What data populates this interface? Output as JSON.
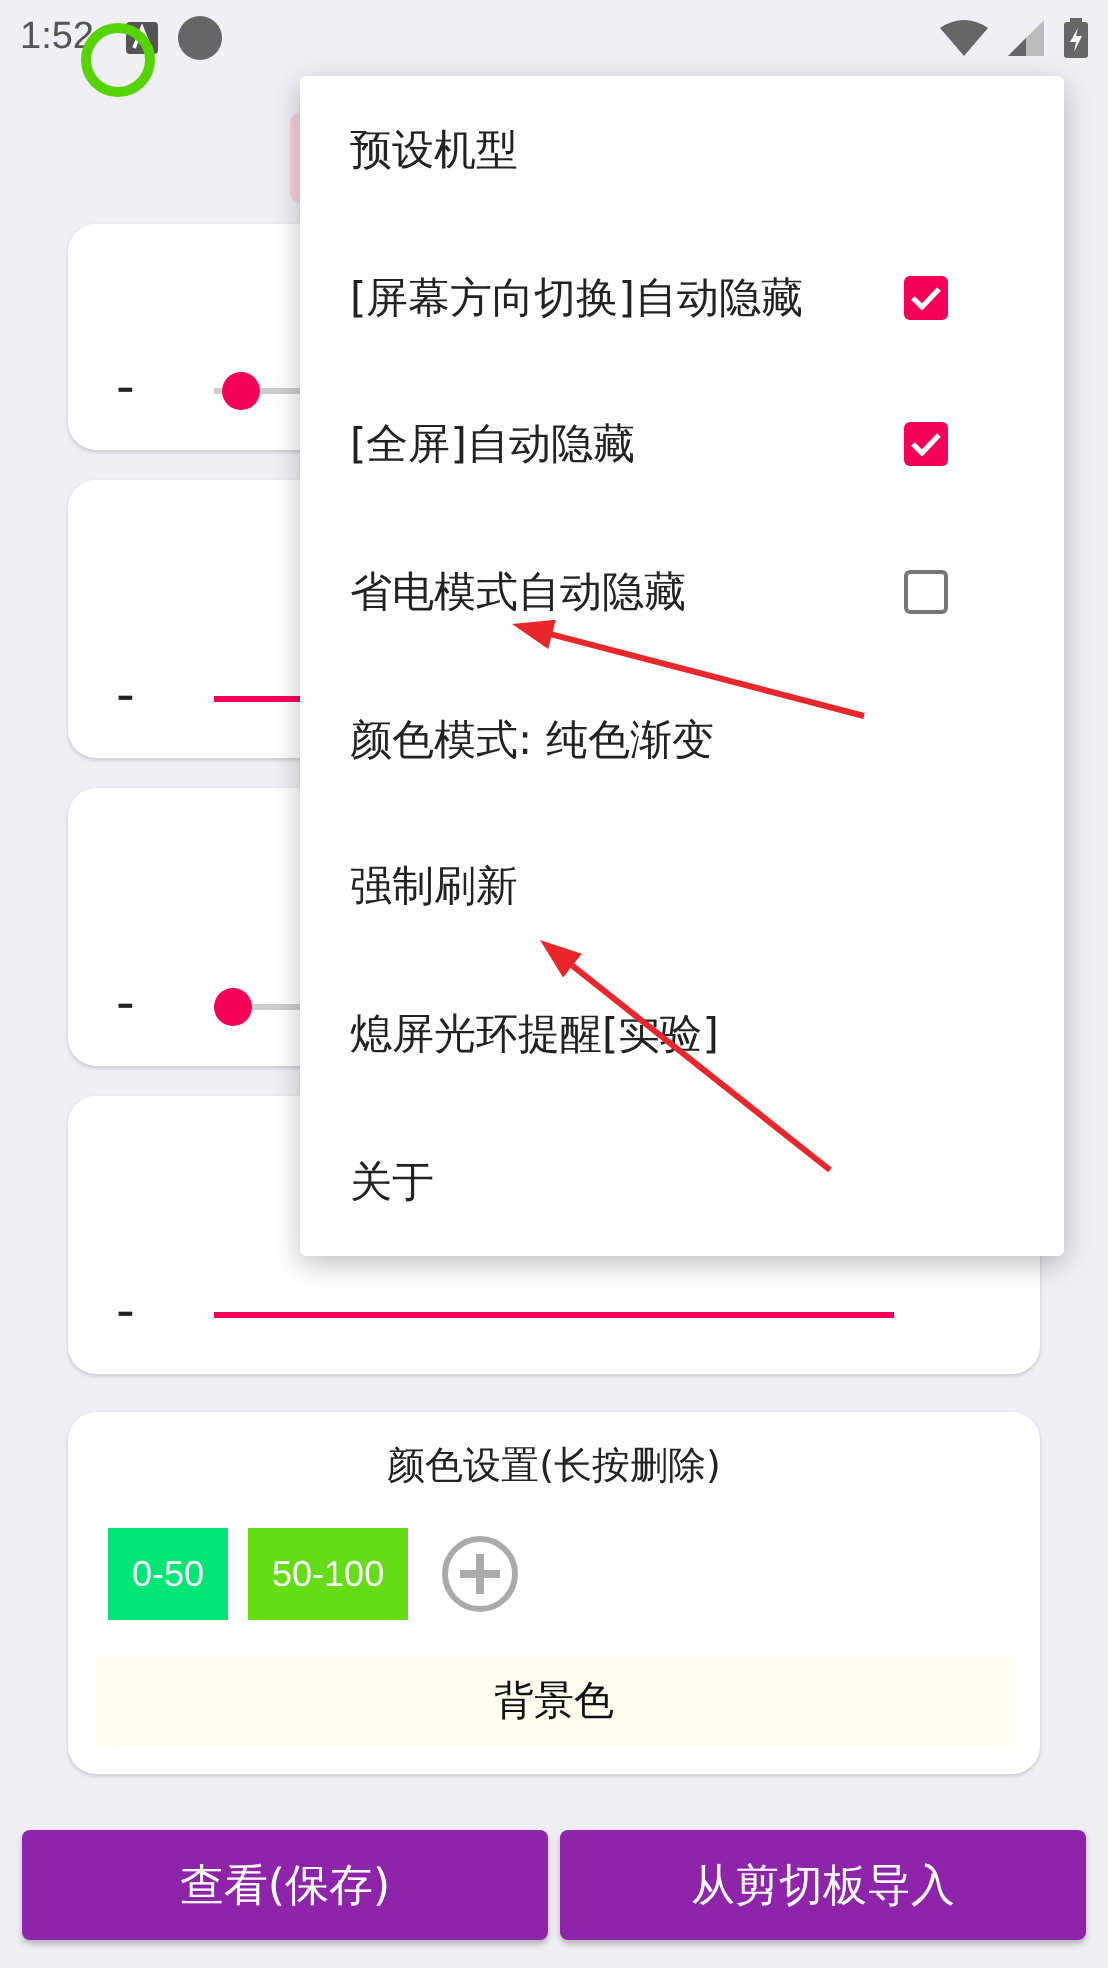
{
  "status_bar": {
    "time": "1:52"
  },
  "cards": [
    {
      "kind": "slider",
      "minus": "-",
      "level": 0.01
    },
    {
      "kind": "line",
      "minus": "-"
    },
    {
      "kind": "slider",
      "minus": "-",
      "level": 0
    },
    {
      "kind": "line",
      "minus": "-"
    }
  ],
  "color_settings": {
    "title": "颜色设置(长按删除)",
    "ranges": [
      {
        "label": "0-50",
        "color": "#00e676"
      },
      {
        "label": "50-100",
        "color": "#64dd17"
      }
    ],
    "background_label": "背景色"
  },
  "buttons": [
    {
      "label": "查看(保存)"
    },
    {
      "label": "从剪切板导入"
    }
  ],
  "menu": {
    "items": [
      {
        "label": "预设机型",
        "kind": "plain"
      },
      {
        "label": "[屏幕方向切换]自动隐藏",
        "kind": "check",
        "checked": true
      },
      {
        "label": "[全屏]自动隐藏",
        "kind": "check",
        "checked": true
      },
      {
        "label": "省电模式自动隐藏",
        "kind": "check",
        "checked": false
      },
      {
        "label": "颜色模式: 纯色渐变",
        "kind": "plain"
      },
      {
        "label": "强制刷新",
        "kind": "plain"
      },
      {
        "label": "熄屏光环提醒[实验]",
        "kind": "plain"
      },
      {
        "label": "关于",
        "kind": "plain"
      }
    ]
  }
}
